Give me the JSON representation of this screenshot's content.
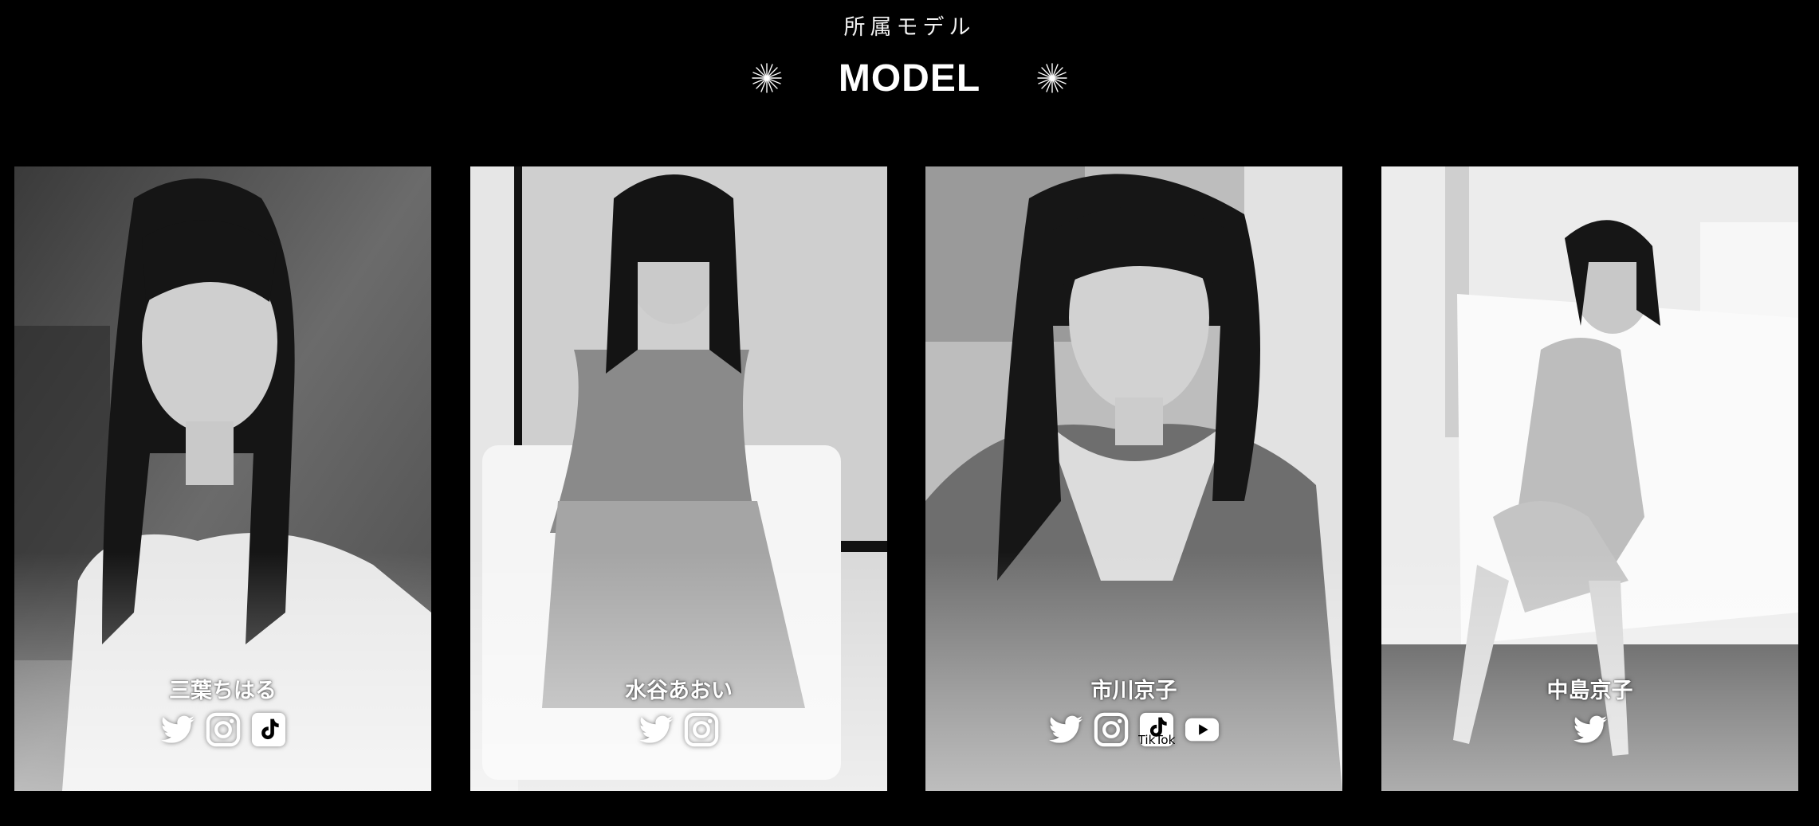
{
  "section": {
    "subtitle": "所属モデル",
    "title": "MODEL"
  },
  "models": [
    {
      "name": "三葉ちはる",
      "socials": [
        "twitter-icon",
        "instagram-icon",
        "tiktok-icon"
      ]
    },
    {
      "name": "水谷あおい",
      "socials": [
        "twitter-icon",
        "instagram-icon"
      ]
    },
    {
      "name": "市川京子",
      "socials": [
        "twitter-icon",
        "instagram-icon",
        "tiktok-icon",
        "youtube-icon"
      ]
    },
    {
      "name": "中島京子",
      "socials": [
        "twitter-icon"
      ]
    }
  ],
  "icons": {
    "tiktok_caption": "TikTok"
  },
  "colors": {
    "background": "#000000",
    "text": "#ffffff"
  }
}
